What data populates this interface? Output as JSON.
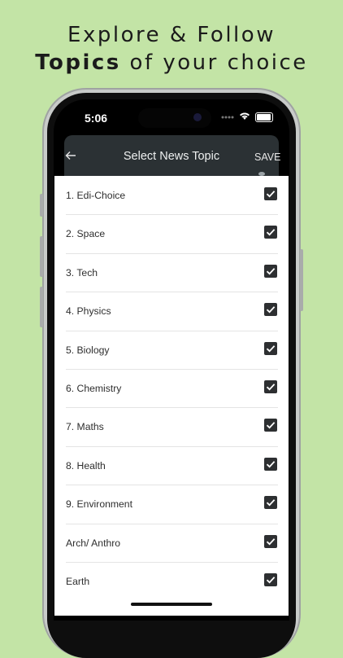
{
  "promo": {
    "line1": "Explore & Follow",
    "line2_bold": "Topics",
    "line2_rest": " of your choice"
  },
  "status_bar": {
    "time": "5:06"
  },
  "header": {
    "title": "Select News Topic",
    "save_label": "SAVE"
  },
  "topics": [
    {
      "label": "1. Edi-Choice",
      "checked": true
    },
    {
      "label": "2. Space",
      "checked": true
    },
    {
      "label": "3. Tech",
      "checked": true
    },
    {
      "label": "4. Physics",
      "checked": true
    },
    {
      "label": "5. Biology",
      "checked": true
    },
    {
      "label": "6. Chemistry",
      "checked": true
    },
    {
      "label": "7. Maths",
      "checked": true
    },
    {
      "label": "8. Health",
      "checked": true
    },
    {
      "label": "9. Environment",
      "checked": true
    },
    {
      "label": "Arch/ Anthro",
      "checked": true
    },
    {
      "label": "Earth",
      "checked": true
    }
  ],
  "colors": {
    "background": "#c3e4a6",
    "header": "#2b3134",
    "checkbox": "#2d2f31"
  }
}
